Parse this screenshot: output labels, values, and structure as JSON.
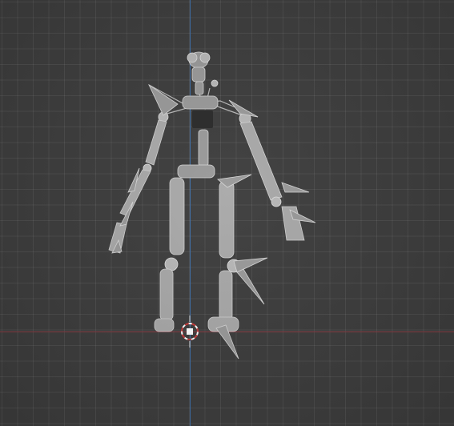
{
  "viewport": {
    "background": "#3d3d3d",
    "grid_color": "#4a4a4a",
    "x_axis_color": "#8a3b43",
    "z_axis_color": "#3f6fa8"
  },
  "scene": {
    "object": "animatronic-skeleton-rig",
    "origin_cursor": "3d-cursor-icon"
  }
}
